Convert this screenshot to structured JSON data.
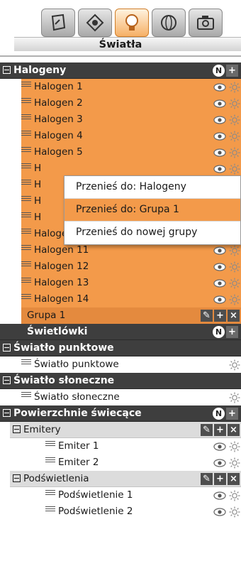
{
  "panel": {
    "title": "Światła"
  },
  "tabs": [
    {
      "icon": "layers-icon",
      "active": false
    },
    {
      "icon": "material-icon",
      "active": false
    },
    {
      "icon": "light-bulb-icon",
      "active": true
    },
    {
      "icon": "environment-icon",
      "active": false
    },
    {
      "icon": "camera-icon",
      "active": false
    }
  ],
  "colors": {
    "accent": "#f39a4a",
    "group_bar": "#3e3e3e",
    "subgroup_bar": "#dcdcdc"
  },
  "halogeny": {
    "label": "Halogeny",
    "items": [
      "Halogen 1",
      "Halogen 2",
      "Halogen 3",
      "Halogen 4",
      "Halogen 5",
      "H",
      "H",
      "H",
      "H",
      "Halogen 10",
      "Halogen 11",
      "Halogen 12",
      "Halogen 13",
      "Halogen 14"
    ],
    "subgroup": "Grupa 1"
  },
  "context_menu": {
    "items": [
      "Przenieś do: Halogeny",
      "Przenieś do: Grupa 1",
      "Przenieś do nowej grupy"
    ],
    "highlighted": 1
  },
  "swietlowki": {
    "label": "Świetlówki"
  },
  "punktowe": {
    "label": "Światło punktowe",
    "items": [
      "Światło punktowe"
    ]
  },
  "sloneczne": {
    "label": "Światło słoneczne",
    "items": [
      "Światło słoneczne"
    ]
  },
  "powierzchnie": {
    "label": "Powierzchnie świecące",
    "emitery": {
      "label": "Emitery",
      "items": [
        "Emiter 1",
        "Emiter 2"
      ]
    },
    "podswietlenia": {
      "label": "Podświetlenia",
      "items": [
        "Podświetlenie 1",
        "Podświetlenie 2"
      ]
    }
  },
  "badges": {
    "new": "N"
  }
}
